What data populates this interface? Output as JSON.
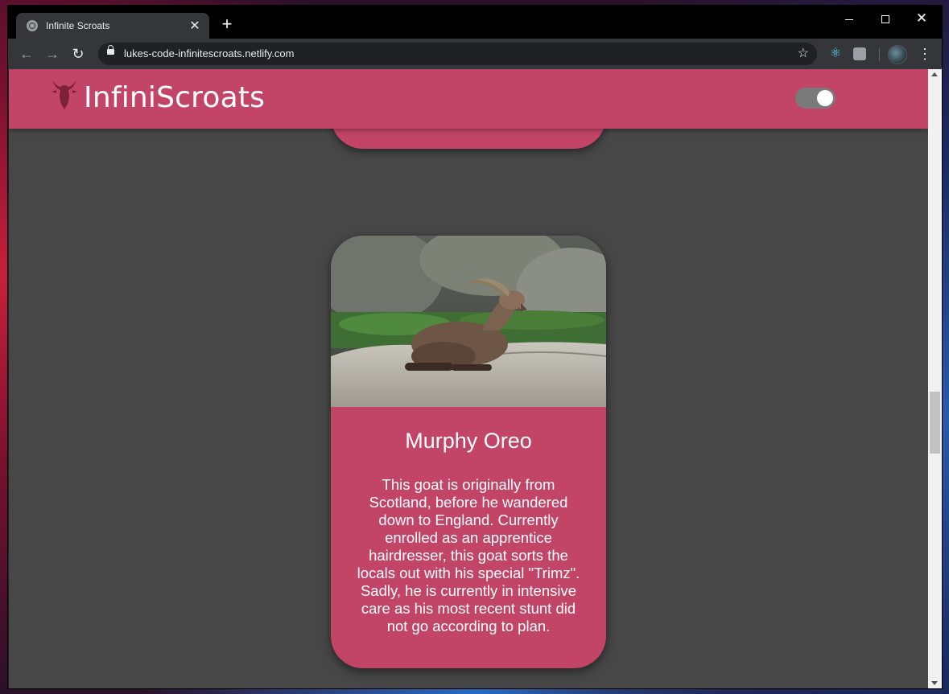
{
  "browser": {
    "tab_title": "Infinite Scroats",
    "tab_close": "✕",
    "new_tab": "+",
    "url": "lukes-code-infinitescroats.netlify.com",
    "window_close": "✕",
    "menu": "⋮",
    "star": "☆",
    "back": "←",
    "forward": "→",
    "reload": "↻"
  },
  "site": {
    "title": "InfiniScroats",
    "theme_toggle_on": true
  },
  "card": {
    "name": "Murphy Oreo",
    "description": "This goat is originally from Scotland, before he wandered down to England. Currently enrolled as an apprentice hairdresser, this goat sorts the locals out with his special \"Trimz\". Sadly, he is currently in intensive care as his most recent stunt did not go according to plan."
  },
  "colors": {
    "brand": "#c24467",
    "page_background": "#474747"
  },
  "icons": {
    "logo": "goat-head-icon",
    "favicon": "globe-icon",
    "extension_1": "react-devtools-icon",
    "extension_2": "extension-icon"
  }
}
